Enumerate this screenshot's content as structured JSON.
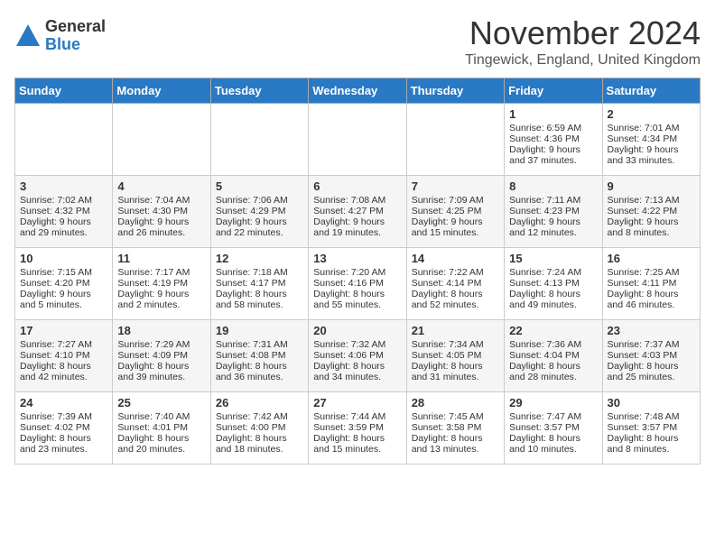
{
  "header": {
    "logo_general": "General",
    "logo_blue": "Blue",
    "month_title": "November 2024",
    "subtitle": "Tingewick, England, United Kingdom"
  },
  "days_of_week": [
    "Sunday",
    "Monday",
    "Tuesday",
    "Wednesday",
    "Thursday",
    "Friday",
    "Saturday"
  ],
  "weeks": [
    [
      {
        "day": "",
        "sunrise": "",
        "sunset": "",
        "daylight": ""
      },
      {
        "day": "",
        "sunrise": "",
        "sunset": "",
        "daylight": ""
      },
      {
        "day": "",
        "sunrise": "",
        "sunset": "",
        "daylight": ""
      },
      {
        "day": "",
        "sunrise": "",
        "sunset": "",
        "daylight": ""
      },
      {
        "day": "",
        "sunrise": "",
        "sunset": "",
        "daylight": ""
      },
      {
        "day": "1",
        "sunrise": "Sunrise: 6:59 AM",
        "sunset": "Sunset: 4:36 PM",
        "daylight": "Daylight: 9 hours and 37 minutes."
      },
      {
        "day": "2",
        "sunrise": "Sunrise: 7:01 AM",
        "sunset": "Sunset: 4:34 PM",
        "daylight": "Daylight: 9 hours and 33 minutes."
      }
    ],
    [
      {
        "day": "3",
        "sunrise": "Sunrise: 7:02 AM",
        "sunset": "Sunset: 4:32 PM",
        "daylight": "Daylight: 9 hours and 29 minutes."
      },
      {
        "day": "4",
        "sunrise": "Sunrise: 7:04 AM",
        "sunset": "Sunset: 4:30 PM",
        "daylight": "Daylight: 9 hours and 26 minutes."
      },
      {
        "day": "5",
        "sunrise": "Sunrise: 7:06 AM",
        "sunset": "Sunset: 4:29 PM",
        "daylight": "Daylight: 9 hours and 22 minutes."
      },
      {
        "day": "6",
        "sunrise": "Sunrise: 7:08 AM",
        "sunset": "Sunset: 4:27 PM",
        "daylight": "Daylight: 9 hours and 19 minutes."
      },
      {
        "day": "7",
        "sunrise": "Sunrise: 7:09 AM",
        "sunset": "Sunset: 4:25 PM",
        "daylight": "Daylight: 9 hours and 15 minutes."
      },
      {
        "day": "8",
        "sunrise": "Sunrise: 7:11 AM",
        "sunset": "Sunset: 4:23 PM",
        "daylight": "Daylight: 9 hours and 12 minutes."
      },
      {
        "day": "9",
        "sunrise": "Sunrise: 7:13 AM",
        "sunset": "Sunset: 4:22 PM",
        "daylight": "Daylight: 9 hours and 8 minutes."
      }
    ],
    [
      {
        "day": "10",
        "sunrise": "Sunrise: 7:15 AM",
        "sunset": "Sunset: 4:20 PM",
        "daylight": "Daylight: 9 hours and 5 minutes."
      },
      {
        "day": "11",
        "sunrise": "Sunrise: 7:17 AM",
        "sunset": "Sunset: 4:19 PM",
        "daylight": "Daylight: 9 hours and 2 minutes."
      },
      {
        "day": "12",
        "sunrise": "Sunrise: 7:18 AM",
        "sunset": "Sunset: 4:17 PM",
        "daylight": "Daylight: 8 hours and 58 minutes."
      },
      {
        "day": "13",
        "sunrise": "Sunrise: 7:20 AM",
        "sunset": "Sunset: 4:16 PM",
        "daylight": "Daylight: 8 hours and 55 minutes."
      },
      {
        "day": "14",
        "sunrise": "Sunrise: 7:22 AM",
        "sunset": "Sunset: 4:14 PM",
        "daylight": "Daylight: 8 hours and 52 minutes."
      },
      {
        "day": "15",
        "sunrise": "Sunrise: 7:24 AM",
        "sunset": "Sunset: 4:13 PM",
        "daylight": "Daylight: 8 hours and 49 minutes."
      },
      {
        "day": "16",
        "sunrise": "Sunrise: 7:25 AM",
        "sunset": "Sunset: 4:11 PM",
        "daylight": "Daylight: 8 hours and 46 minutes."
      }
    ],
    [
      {
        "day": "17",
        "sunrise": "Sunrise: 7:27 AM",
        "sunset": "Sunset: 4:10 PM",
        "daylight": "Daylight: 8 hours and 42 minutes."
      },
      {
        "day": "18",
        "sunrise": "Sunrise: 7:29 AM",
        "sunset": "Sunset: 4:09 PM",
        "daylight": "Daylight: 8 hours and 39 minutes."
      },
      {
        "day": "19",
        "sunrise": "Sunrise: 7:31 AM",
        "sunset": "Sunset: 4:08 PM",
        "daylight": "Daylight: 8 hours and 36 minutes."
      },
      {
        "day": "20",
        "sunrise": "Sunrise: 7:32 AM",
        "sunset": "Sunset: 4:06 PM",
        "daylight": "Daylight: 8 hours and 34 minutes."
      },
      {
        "day": "21",
        "sunrise": "Sunrise: 7:34 AM",
        "sunset": "Sunset: 4:05 PM",
        "daylight": "Daylight: 8 hours and 31 minutes."
      },
      {
        "day": "22",
        "sunrise": "Sunrise: 7:36 AM",
        "sunset": "Sunset: 4:04 PM",
        "daylight": "Daylight: 8 hours and 28 minutes."
      },
      {
        "day": "23",
        "sunrise": "Sunrise: 7:37 AM",
        "sunset": "Sunset: 4:03 PM",
        "daylight": "Daylight: 8 hours and 25 minutes."
      }
    ],
    [
      {
        "day": "24",
        "sunrise": "Sunrise: 7:39 AM",
        "sunset": "Sunset: 4:02 PM",
        "daylight": "Daylight: 8 hours and 23 minutes."
      },
      {
        "day": "25",
        "sunrise": "Sunrise: 7:40 AM",
        "sunset": "Sunset: 4:01 PM",
        "daylight": "Daylight: 8 hours and 20 minutes."
      },
      {
        "day": "26",
        "sunrise": "Sunrise: 7:42 AM",
        "sunset": "Sunset: 4:00 PM",
        "daylight": "Daylight: 8 hours and 18 minutes."
      },
      {
        "day": "27",
        "sunrise": "Sunrise: 7:44 AM",
        "sunset": "Sunset: 3:59 PM",
        "daylight": "Daylight: 8 hours and 15 minutes."
      },
      {
        "day": "28",
        "sunrise": "Sunrise: 7:45 AM",
        "sunset": "Sunset: 3:58 PM",
        "daylight": "Daylight: 8 hours and 13 minutes."
      },
      {
        "day": "29",
        "sunrise": "Sunrise: 7:47 AM",
        "sunset": "Sunset: 3:57 PM",
        "daylight": "Daylight: 8 hours and 10 minutes."
      },
      {
        "day": "30",
        "sunrise": "Sunrise: 7:48 AM",
        "sunset": "Sunset: 3:57 PM",
        "daylight": "Daylight: 8 hours and 8 minutes."
      }
    ]
  ]
}
